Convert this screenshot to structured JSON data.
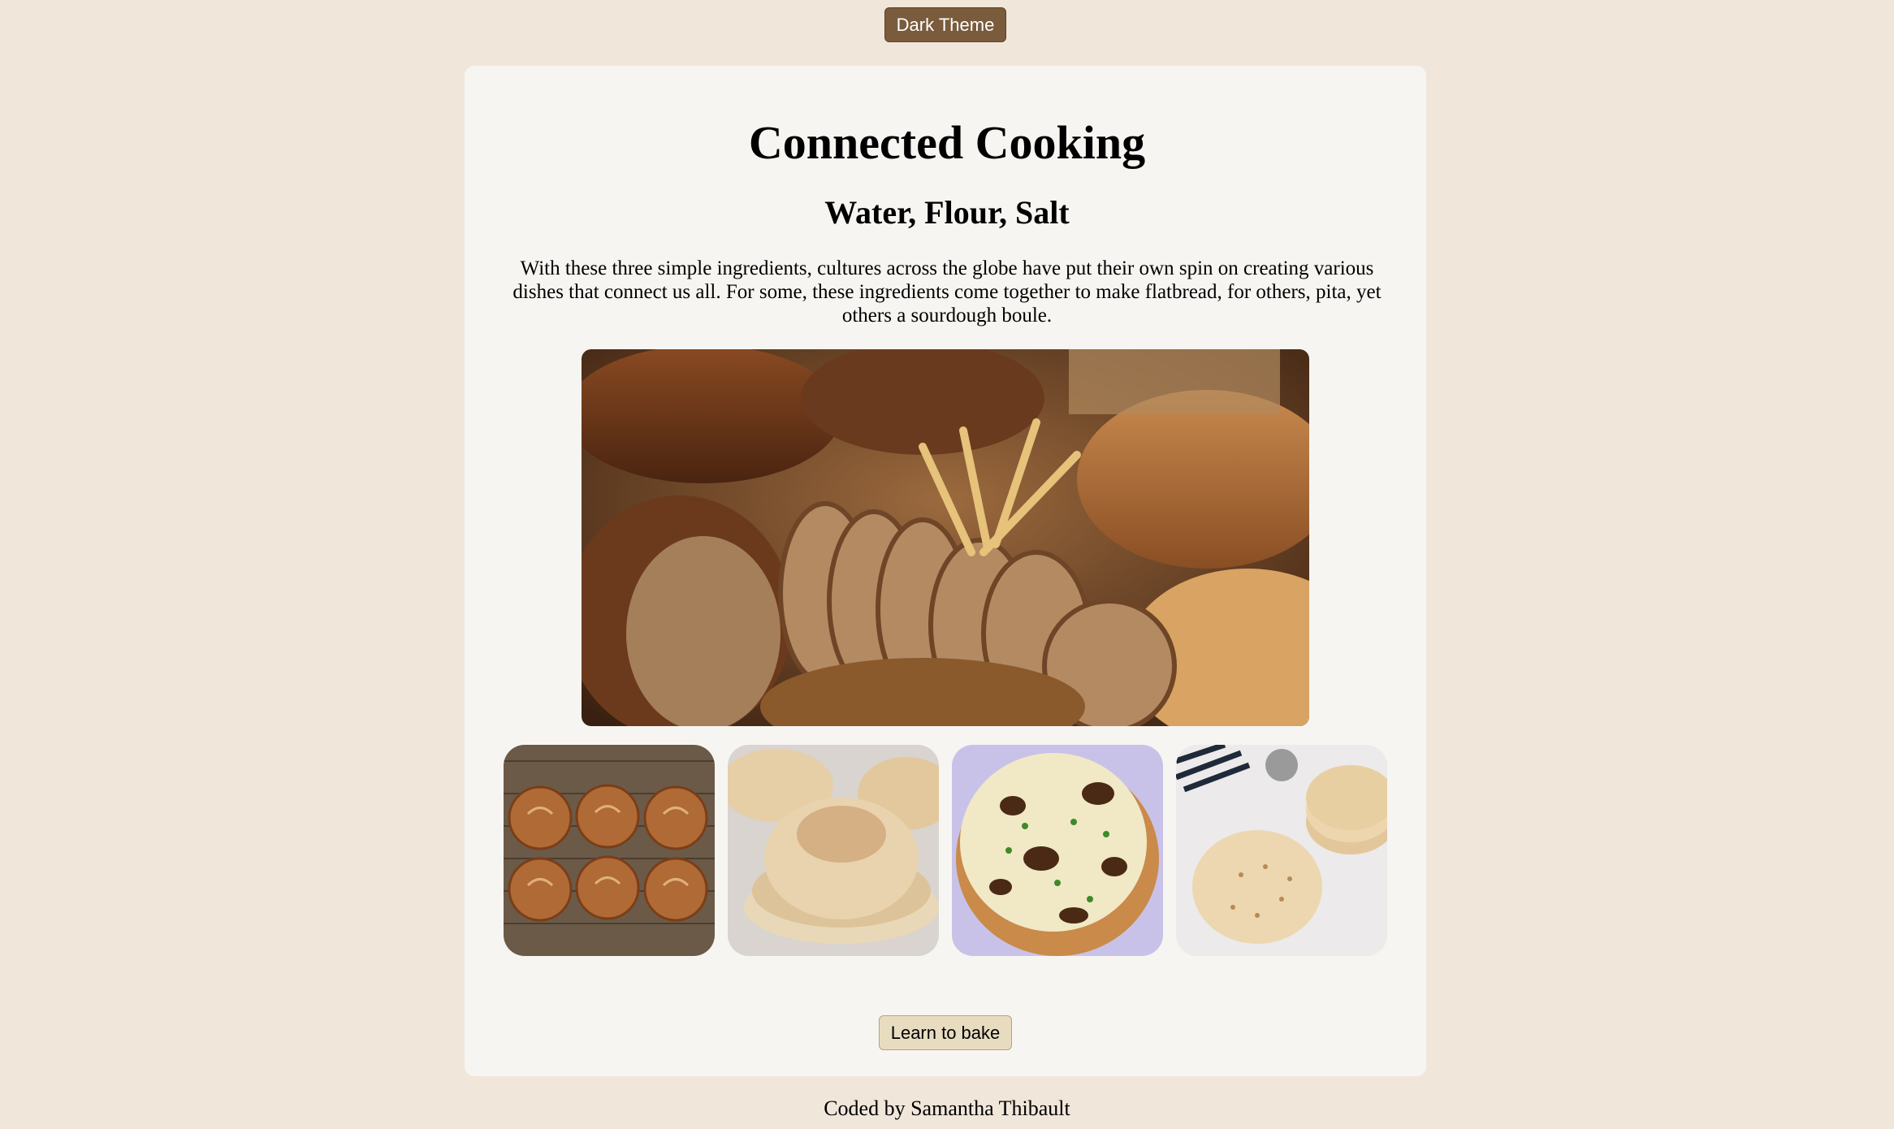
{
  "header": {
    "theme_toggle_label": "Dark Theme"
  },
  "main": {
    "title": "Connected Cooking",
    "subtitle": "Water, Flour, Salt",
    "intro": "With these three simple ingredients, cultures across the globe have put their own spin on creating various dishes that connect us all. For some, these ingredients come together to make flatbread, for others, pita, yet others a sourdough boule.",
    "hero_image": {
      "icon": "bread-assortment-photo"
    },
    "gallery": [
      {
        "icon": "sourdough-boules-photo"
      },
      {
        "icon": "pita-bread-photo"
      },
      {
        "icon": "naan-flatbread-photo"
      },
      {
        "icon": "tortilla-flatbread-photo"
      }
    ],
    "cta_label": "Learn to bake"
  },
  "footer": {
    "credit": "Coded by Samantha Thibault"
  },
  "colors": {
    "page_background": "#f0e6da",
    "card_background": "#f7f5f2",
    "theme_button": "#7a5b3c",
    "cta_button": "#e8dcc0"
  }
}
